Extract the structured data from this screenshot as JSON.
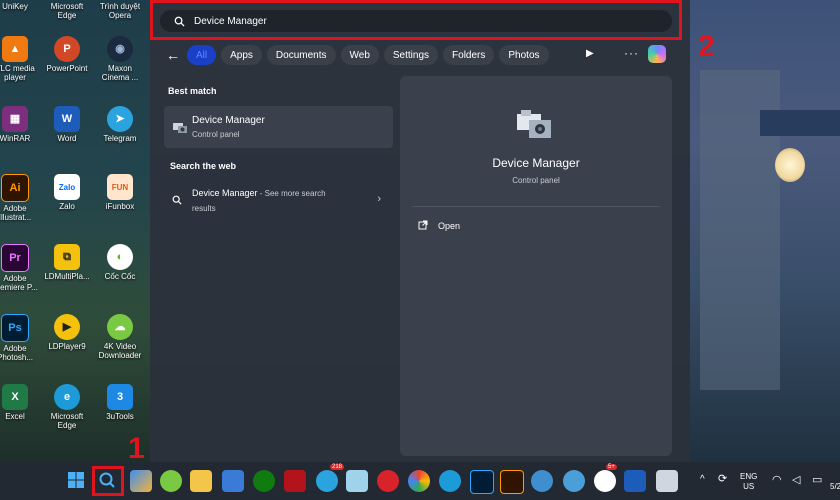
{
  "desktop_icons": [
    {
      "label": "UniKey"
    },
    {
      "label": "Microsoft Edge"
    },
    {
      "label": "Trình duyệt Opera"
    },
    {
      "label": "VLC media player"
    },
    {
      "label": "PowerPoint"
    },
    {
      "label": "Maxon Cinema ..."
    },
    {
      "label": "WinRAR"
    },
    {
      "label": "Word"
    },
    {
      "label": "Telegram"
    },
    {
      "label": "Adobe Illustrat..."
    },
    {
      "label": "Zalo"
    },
    {
      "label": "iFunbox"
    },
    {
      "label": "Adobe Premiere P..."
    },
    {
      "label": "LDMultiPla..."
    },
    {
      "label": "Cốc Cốc"
    },
    {
      "label": "Adobe Photosh..."
    },
    {
      "label": "LDPlayer9"
    },
    {
      "label": "4K Video Downloader"
    },
    {
      "label": "Excel"
    },
    {
      "label": "Microsoft Edge"
    },
    {
      "label": "3uTools"
    }
  ],
  "search": {
    "value": "Device Manager"
  },
  "filters": {
    "all": "All",
    "apps": "Apps",
    "documents": "Documents",
    "web": "Web",
    "settings": "Settings",
    "folders": "Folders",
    "photos": "Photos"
  },
  "best_match": {
    "heading": "Best match",
    "title": "Device Manager",
    "subtitle": "Control panel"
  },
  "search_web": {
    "heading": "Search the web",
    "title": "Device Manager",
    "suffix": " - See more search",
    "suffix2": "results"
  },
  "detail": {
    "title": "Device Manager",
    "subtitle": "Control panel",
    "open_label": "Open"
  },
  "annotations": {
    "step1": "1",
    "step2": "2"
  },
  "tray": {
    "lang_top": "ENG",
    "lang_bottom": "US",
    "time_partial": "5/2"
  },
  "taskbar_badges": {
    "telegram": "218",
    "chat": "5+"
  },
  "colors": {
    "highlight_red": "#e0141c",
    "accent_blue": "#1a3fc9",
    "panel_bg": "#2c323c"
  }
}
